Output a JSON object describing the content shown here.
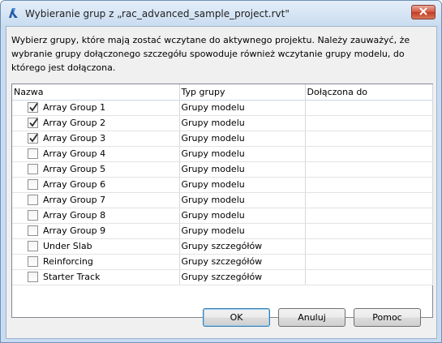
{
  "window": {
    "title": "Wybieranie grup z „rac_advanced_sample_project.rvt\"",
    "app_icon": "revit-logo-icon",
    "close_icon": "close-icon"
  },
  "instruction": "Wybierz grupy, które mają zostać wczytane do aktywnego projektu. Należy zauważyć, że wybranie grupy dołączonego szczegółu spowoduje również wczytanie grupy modelu, do którego jest dołączona.",
  "table": {
    "columns": [
      "Nazwa",
      "Typ grupy",
      "Dołączona do"
    ],
    "rows": [
      {
        "name": "Array Group 1",
        "type": "Grupy modelu",
        "attached": "",
        "checked": true
      },
      {
        "name": "Array Group 2",
        "type": "Grupy modelu",
        "attached": "",
        "checked": true
      },
      {
        "name": "Array Group 3",
        "type": "Grupy modelu",
        "attached": "",
        "checked": true
      },
      {
        "name": "Array Group 4",
        "type": "Grupy modelu",
        "attached": "",
        "checked": false
      },
      {
        "name": "Array Group 5",
        "type": "Grupy modelu",
        "attached": "",
        "checked": false
      },
      {
        "name": "Array Group 6",
        "type": "Grupy modelu",
        "attached": "",
        "checked": false
      },
      {
        "name": "Array Group 7",
        "type": "Grupy modelu",
        "attached": "",
        "checked": false
      },
      {
        "name": "Array Group 8",
        "type": "Grupy modelu",
        "attached": "",
        "checked": false
      },
      {
        "name": "Array Group 9",
        "type": "Grupy modelu",
        "attached": "",
        "checked": false
      },
      {
        "name": "Under Slab",
        "type": "Grupy szczegółów",
        "attached": "",
        "checked": false
      },
      {
        "name": "Reinforcing",
        "type": "Grupy szczegółów",
        "attached": "",
        "checked": false
      },
      {
        "name": "Starter Track",
        "type": "Grupy szczegółów",
        "attached": "",
        "checked": false
      }
    ]
  },
  "buttons": {
    "ok": "OK",
    "cancel": "Anuluj",
    "help": "Pomoc"
  }
}
